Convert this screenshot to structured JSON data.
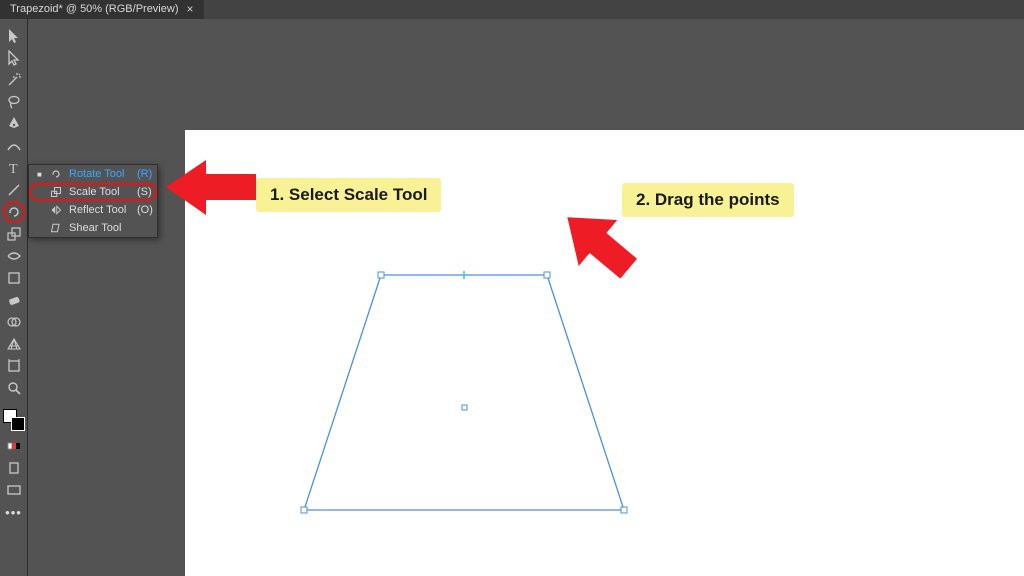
{
  "tab": {
    "title": "Trapezoid* @ 50% (RGB/Preview)"
  },
  "flyout": {
    "items": [
      {
        "label": "Rotate Tool",
        "shortcut": "(R)"
      },
      {
        "label": "Scale Tool",
        "shortcut": "(S)"
      },
      {
        "label": "Reflect Tool",
        "shortcut": "(O)"
      },
      {
        "label": "Shear Tool",
        "shortcut": ""
      }
    ]
  },
  "annotations": {
    "step1": "1. Select Scale Tool",
    "step2": "2. Drag the points"
  }
}
